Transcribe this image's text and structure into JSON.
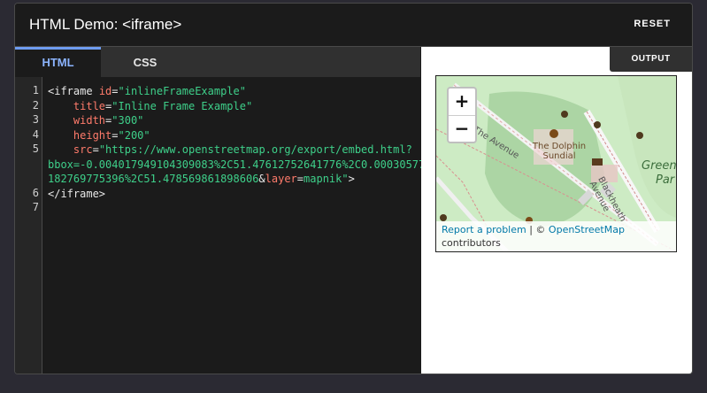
{
  "header": {
    "title": "HTML Demo: <iframe>",
    "reset_label": "RESET"
  },
  "tabs": [
    {
      "label": "HTML",
      "active": true
    },
    {
      "label": "CSS",
      "active": false
    }
  ],
  "output": {
    "tab_label": "OUTPUT"
  },
  "editor": {
    "line_numbers": [
      "1",
      "2",
      "3",
      "4",
      "5",
      "6",
      "7"
    ]
  },
  "map": {
    "zoom_in": "+",
    "zoom_out": "−",
    "labels": {
      "avenue": "The Avenue",
      "dolphin": "The Dolphin\nSundial",
      "blackheath": "Blackheath Avenue",
      "green": "Green",
      "par": "Par"
    },
    "attribution": {
      "report": "Report a problem",
      "separator": " | © ",
      "osm": "OpenStreetMap",
      "contributors": "contributors"
    }
  },
  "colors": {
    "tag": "#e8e8e8",
    "attr": "#ff7b6b",
    "val": "#3ed08a",
    "active_tab": "#8cb4ff"
  }
}
